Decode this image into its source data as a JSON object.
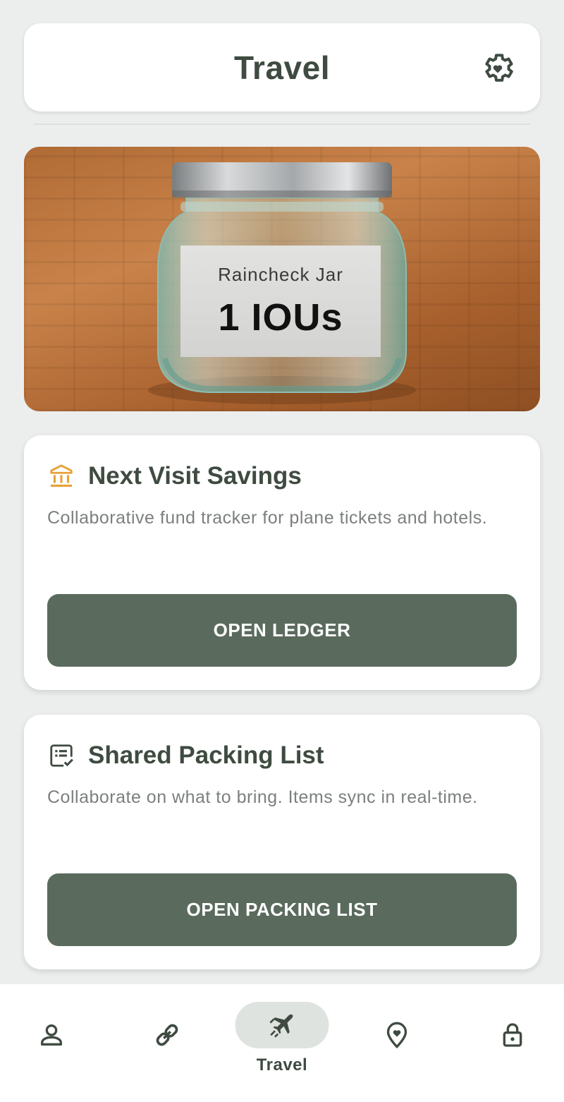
{
  "header": {
    "title": "Travel",
    "settings_icon": "gear-heart-icon"
  },
  "hero": {
    "label_title": "Raincheck Jar",
    "iou_count": "1 IOUs"
  },
  "cards": {
    "savings": {
      "icon": "bank-icon",
      "title": "Next Visit Savings",
      "description": "Collaborative fund tracker for plane tickets and hotels.",
      "button_label": "OPEN LEDGER"
    },
    "packing": {
      "icon": "checklist-icon",
      "title": "Shared Packing List",
      "description": "Collaborate on what to bring. Items sync in real-time.",
      "button_label": "OPEN PACKING LIST"
    }
  },
  "nav": {
    "items": [
      {
        "icon": "person-icon",
        "label": ""
      },
      {
        "icon": "link-icon",
        "label": ""
      },
      {
        "icon": "airplane-icon",
        "label": "Travel",
        "active": true
      },
      {
        "icon": "location-heart-icon",
        "label": ""
      },
      {
        "icon": "lock-icon",
        "label": ""
      }
    ]
  },
  "colors": {
    "primary": "#5a6b5d",
    "text_dark": "#3f4b41",
    "text_muted": "#7b807d",
    "background": "#eceeee",
    "accent_gold": "#e8a23a",
    "nav_pill": "#dfe3df"
  }
}
